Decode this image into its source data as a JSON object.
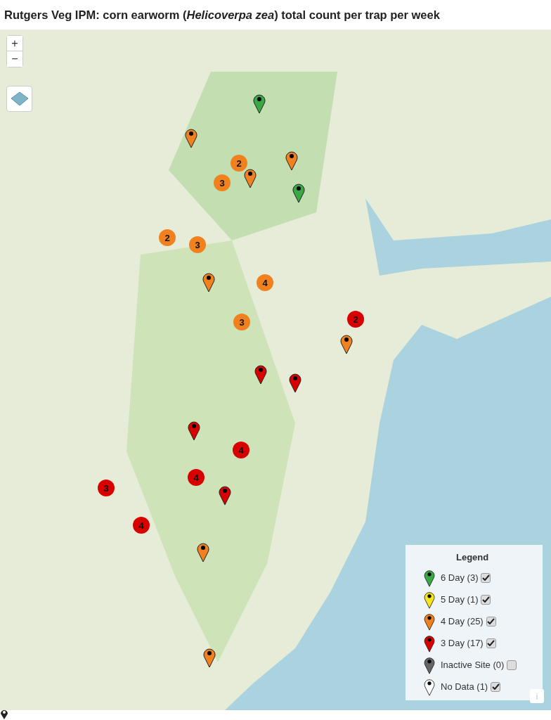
{
  "title": "Rutgers Veg IPM: corn earworm (*Helicoverpa zea*) total count per trap per week",
  "map": {
    "zoom_in": "+",
    "zoom_out": "−",
    "markers": [
      {
        "kind": "pin",
        "color": "#3aa845"
      },
      {
        "kind": "pin",
        "color": "#f0811e"
      },
      {
        "kind": "pin",
        "color": "#f0811e"
      },
      {
        "kind": "pin",
        "color": "#f0811e"
      },
      {
        "kind": "pin",
        "color": "#3aa845"
      },
      {
        "kind": "pin",
        "color": "#f0811e"
      },
      {
        "kind": "pin",
        "color": "#f0811e"
      },
      {
        "kind": "pin",
        "color": "#d90000"
      },
      {
        "kind": "pin",
        "color": "#d90000"
      },
      {
        "kind": "pin",
        "color": "#d90000"
      },
      {
        "kind": "pin",
        "color": "#d90000"
      },
      {
        "kind": "pin",
        "color": "#f0811e"
      },
      {
        "kind": "pin",
        "color": "#f0811e"
      },
      {
        "kind": "cluster",
        "count": "2",
        "color": "#f0811e"
      },
      {
        "kind": "cluster",
        "count": "3",
        "color": "#f0811e"
      },
      {
        "kind": "cluster",
        "count": "2",
        "color": "#f0811e"
      },
      {
        "kind": "cluster",
        "count": "3",
        "color": "#f0811e"
      },
      {
        "kind": "cluster",
        "count": "4",
        "color": "#f0811e"
      },
      {
        "kind": "cluster",
        "count": "3",
        "color": "#f0811e"
      },
      {
        "kind": "cluster",
        "count": "2",
        "color": "#d90000"
      },
      {
        "kind": "cluster",
        "count": "4",
        "color": "#d90000"
      },
      {
        "kind": "cluster",
        "count": "4",
        "color": "#d90000"
      },
      {
        "kind": "cluster",
        "count": "3",
        "color": "#d90000"
      },
      {
        "kind": "cluster",
        "count": "4",
        "color": "#d90000"
      }
    ],
    "legend": {
      "title": "Legend",
      "items": [
        {
          "label": "6 Day (3)",
          "color": "#3aa845",
          "checked": true
        },
        {
          "label": "5 Day (1)",
          "color": "#f5e61e",
          "checked": true
        },
        {
          "label": "4 Day (25)",
          "color": "#f0811e",
          "checked": true
        },
        {
          "label": "3 Day (17)",
          "color": "#d90000",
          "checked": true
        },
        {
          "label": "Inactive Site (0)",
          "color": "#666666",
          "checked": false
        },
        {
          "label": "No Data (1)",
          "color": "#ffffff",
          "checked": true
        }
      ]
    },
    "info_button": "i"
  }
}
